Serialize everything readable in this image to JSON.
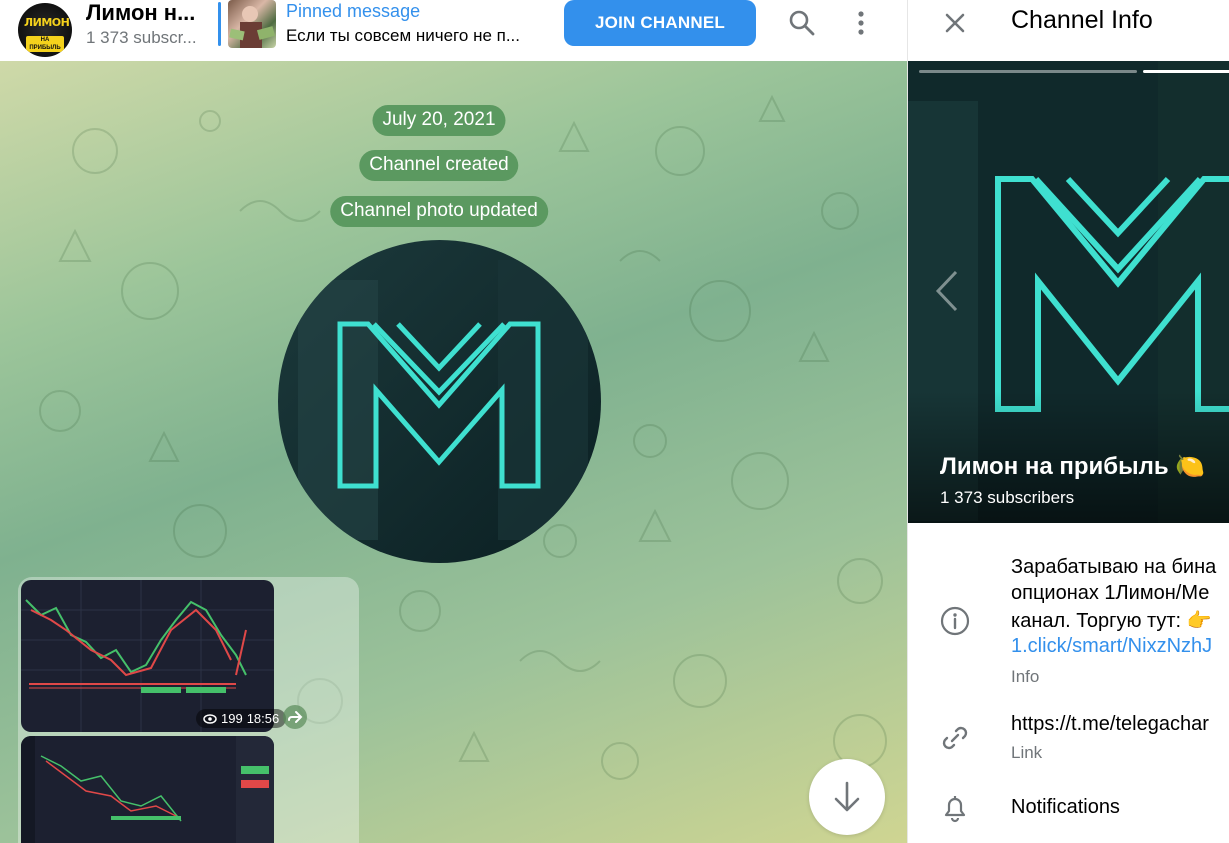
{
  "header": {
    "channel_title": "Лимон н...",
    "channel_subtitle": "1 373 subscr...",
    "avatar_text": "ЛИМОН",
    "avatar_sub": "НА ПРИБЫЛЬ",
    "pinned_title": "Pinned message",
    "pinned_text": "Если ты совсем ничего не п...",
    "join_label": "JOIN CHANNEL",
    "search_icon": "search-icon",
    "more_icon": "more-vertical-icon"
  },
  "chat": {
    "date_pill": "July 20, 2021",
    "created_pill": "Channel created",
    "photo_updated_pill": "Channel photo updated",
    "views": "199",
    "time": "18:56"
  },
  "info": {
    "title": "Channel Info",
    "name": "Лимон на прибыль 🍋",
    "subscribers": "1 373 subscribers",
    "description_lines": [
      "Зарабатываю на бина",
      "опционах 1Лимон/Ме",
      "канал. Торгую тут: 👉"
    ],
    "description_link": "1.click/smart/NixzNzhJ",
    "info_label": "Info",
    "link_value": "https://t.me/telegachar",
    "link_label": "Link",
    "notifications_label": "Notifications"
  },
  "colors": {
    "accent": "#3390ec",
    "pill": "#5b9960",
    "logo_cyan": "#3fe0d0"
  }
}
